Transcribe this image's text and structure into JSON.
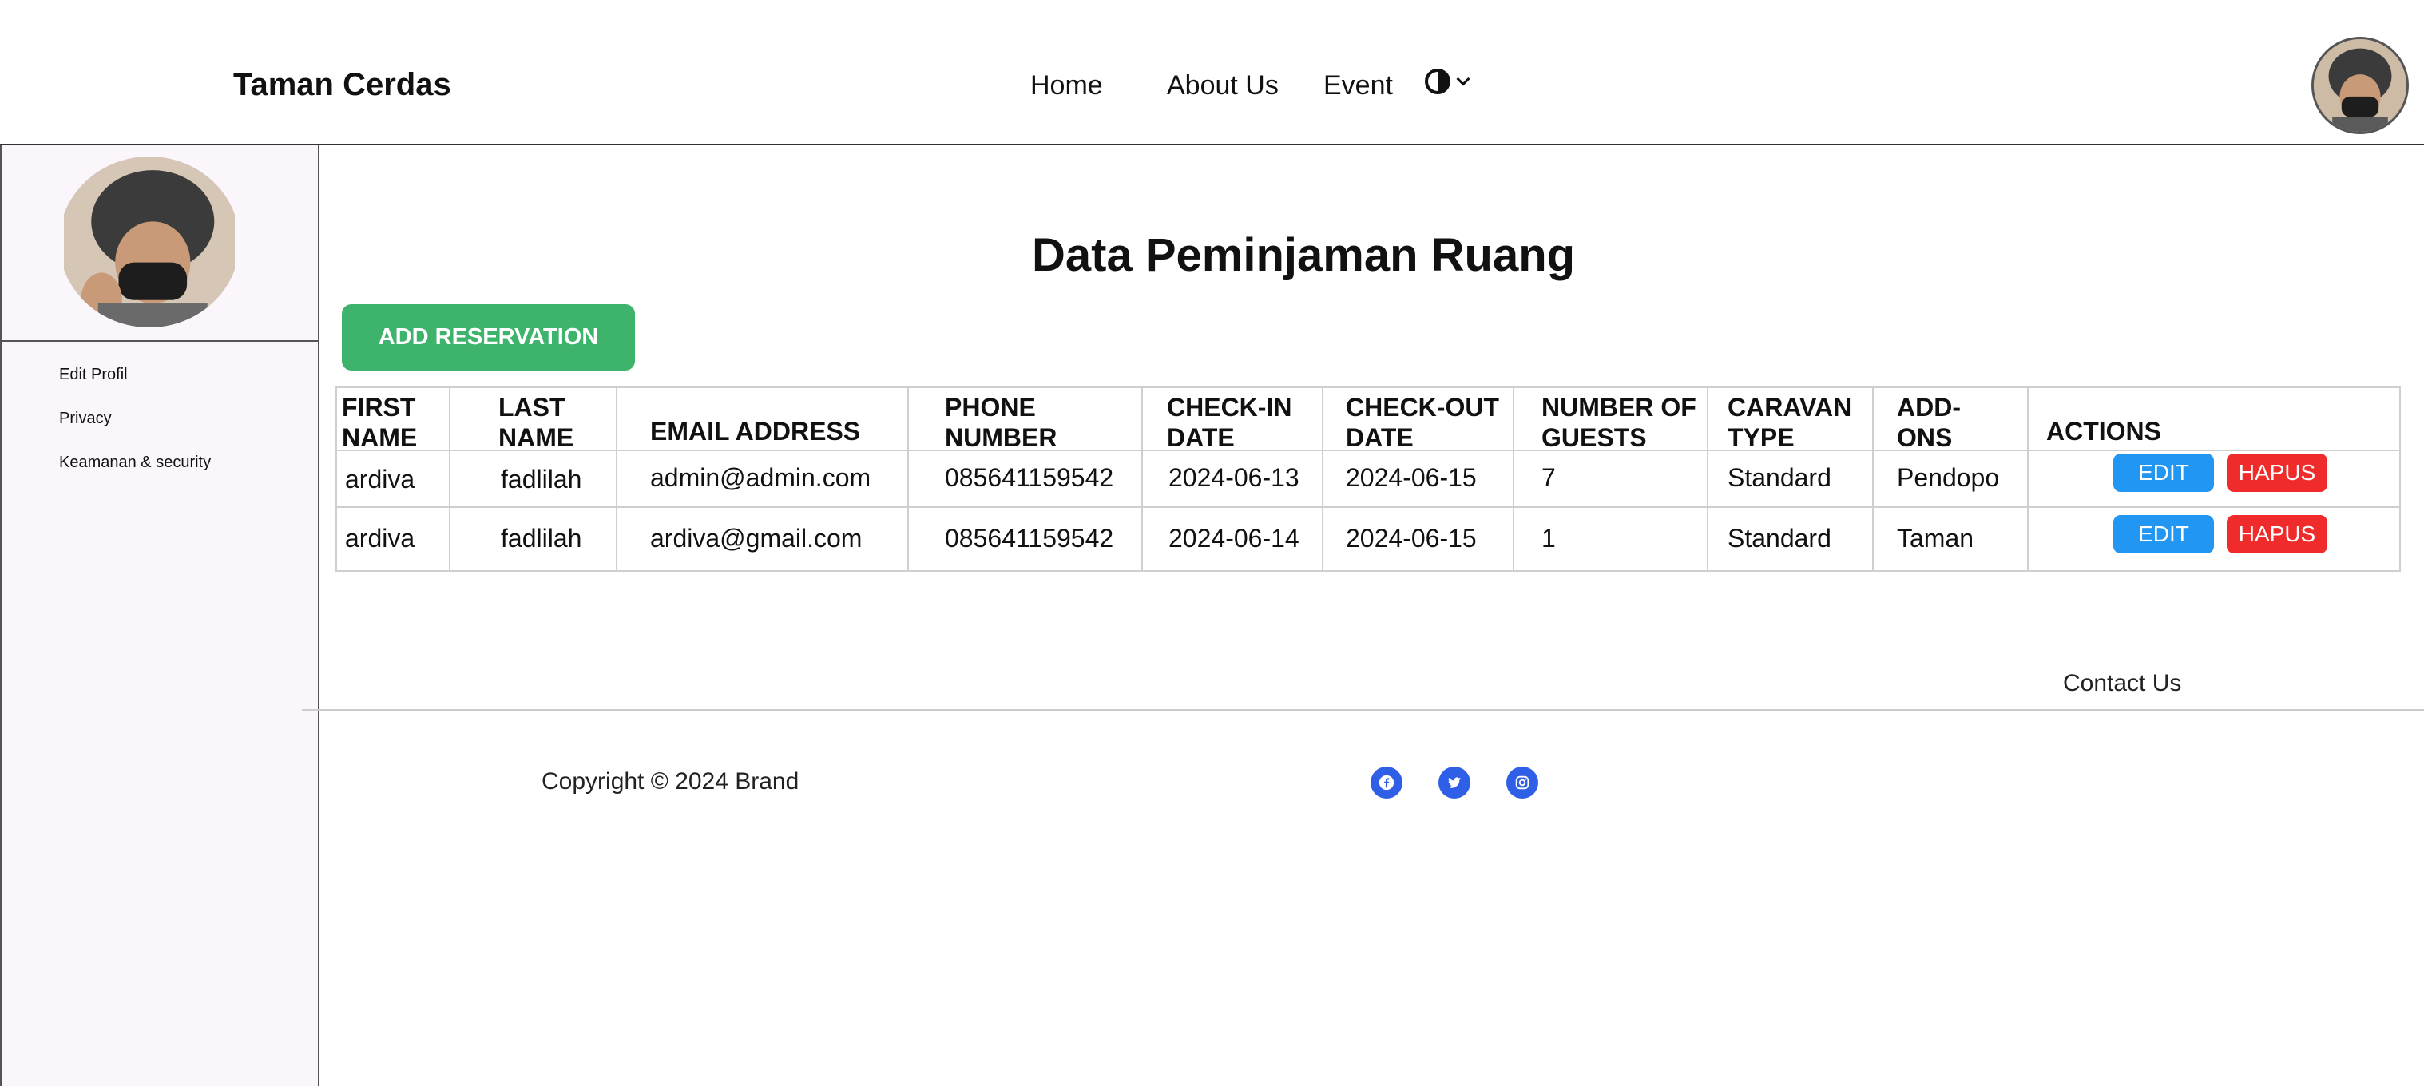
{
  "header": {
    "brand": "Taman Cerdas",
    "nav": [
      "Home",
      "About Us",
      "Event"
    ],
    "theme_icon": "contrast-icon",
    "avatar_icon": "profile-avatar"
  },
  "sidebar": {
    "avatar_icon": "profile-avatar",
    "links": [
      "Edit Profil",
      "Privacy",
      "Keamanan & security"
    ]
  },
  "main": {
    "title": "Data Peminjaman Ruang",
    "add_button": "ADD RESERVATION",
    "table": {
      "headers": [
        [
          "FIRST",
          "NAME"
        ],
        [
          "LAST",
          "NAME"
        ],
        [
          "EMAIL ADDRESS"
        ],
        [
          "PHONE",
          "NUMBER"
        ],
        [
          "CHECK-IN",
          "DATE"
        ],
        [
          "CHECK-OUT",
          "DATE"
        ],
        [
          "NUMBER OF",
          "GUESTS"
        ],
        [
          "CARAVAN",
          "TYPE"
        ],
        [
          "ADD-",
          "ONS"
        ],
        [
          "ACTIONS"
        ]
      ],
      "rows": [
        [
          "ardiva",
          "fadlilah",
          "admin@admin.com",
          "085641159542",
          "2024-06-13",
          "2024-06-15",
          "7",
          "Standard",
          "Pendopo"
        ],
        [
          "ardiva",
          "fadlilah",
          "ardiva@gmail.com",
          "085641159542",
          "2024-06-14",
          "2024-06-15",
          "1",
          "Standard",
          "Taman"
        ]
      ],
      "edit_label": "EDIT",
      "delete_label": "HAPUS"
    }
  },
  "footer": {
    "contact": "Contact Us",
    "copyright": "Copyright © 2024 Brand",
    "social_icons": [
      "facebook-icon",
      "twitter-icon",
      "instagram-icon"
    ]
  },
  "colors": {
    "add_button": "#3db36b",
    "edit_button": "#2196f3",
    "delete_button": "#ef2b2b",
    "social": "#2f5fe6",
    "sidebar_bg": "#fbf6fc"
  }
}
